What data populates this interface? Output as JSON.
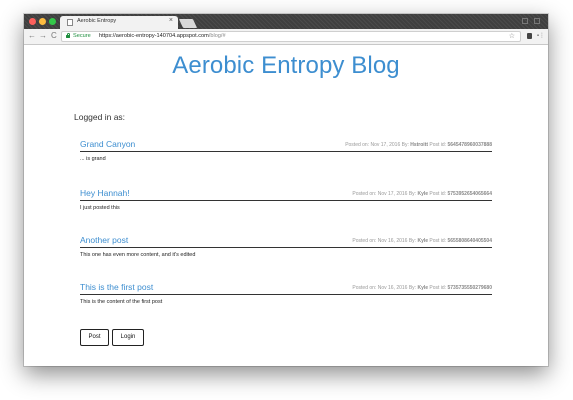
{
  "browser": {
    "tab_title": "Aerobic Entropy",
    "tab_close": "×",
    "secure_label": "Secure",
    "url_host": "https://aerobic-entropy-140704.appspot.com",
    "url_path": "/blog/#",
    "nav_back": "←",
    "nav_forward": "→",
    "nav_reload": "C",
    "star": "☆"
  },
  "page": {
    "title": "Aerobic Entropy Blog",
    "logged_in_label": "Logged in as:"
  },
  "posts": [
    {
      "title": "Grand Canyon",
      "posted_on": "Nov 17, 2016",
      "author": "Hstroitt",
      "post_id": "5645478960037888",
      "body": "... is grand"
    },
    {
      "title": "Hey Hannah!",
      "posted_on": "Nov 17, 2016",
      "author": "Kyle",
      "post_id": "5753952654065664",
      "body": "I just posted this"
    },
    {
      "title": "Another post",
      "posted_on": "Nov 16, 2016",
      "author": "Kyle",
      "post_id": "5655808640405504",
      "body": "This one has even more content, and it's edited"
    },
    {
      "title": "This is the first post",
      "posted_on": "Nov 16, 2016",
      "author": "Kyle",
      "post_id": "5735735550279680",
      "body": "This is the content of the first post"
    }
  ],
  "meta_labels": {
    "posted_on": "Posted on:",
    "by": "By:",
    "post_id": "Post id:"
  },
  "buttons": {
    "post": "Post",
    "login": "Login"
  },
  "colors": {
    "accent": "#3d8ed0",
    "secure": "#1e8e3e"
  }
}
